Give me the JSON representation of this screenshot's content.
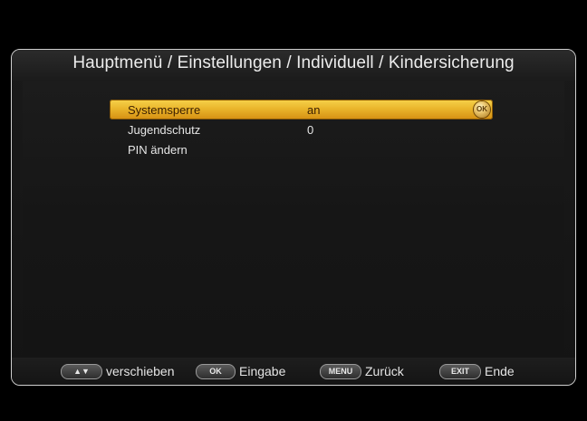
{
  "title": "Hauptmenü / Einstellungen / Individuell / Kindersicherung",
  "menu": {
    "items": [
      {
        "label": "Systemsperre",
        "value": "an",
        "selected": true
      },
      {
        "label": "Jugendschutz",
        "value": "0",
        "selected": false
      },
      {
        "label": "PIN ändern",
        "value": "",
        "selected": false
      }
    ],
    "ok_badge": "OK"
  },
  "footer": {
    "hints": [
      {
        "key": "▲▼",
        "label": "verschieben"
      },
      {
        "key": "OK",
        "label": "Eingabe"
      },
      {
        "key": "MENU",
        "label": "Zurück"
      },
      {
        "key": "EXIT",
        "label": "Ende"
      }
    ]
  },
  "colors": {
    "highlight": "#eab62c",
    "background": "#161616",
    "text": "#e6e6e6"
  }
}
